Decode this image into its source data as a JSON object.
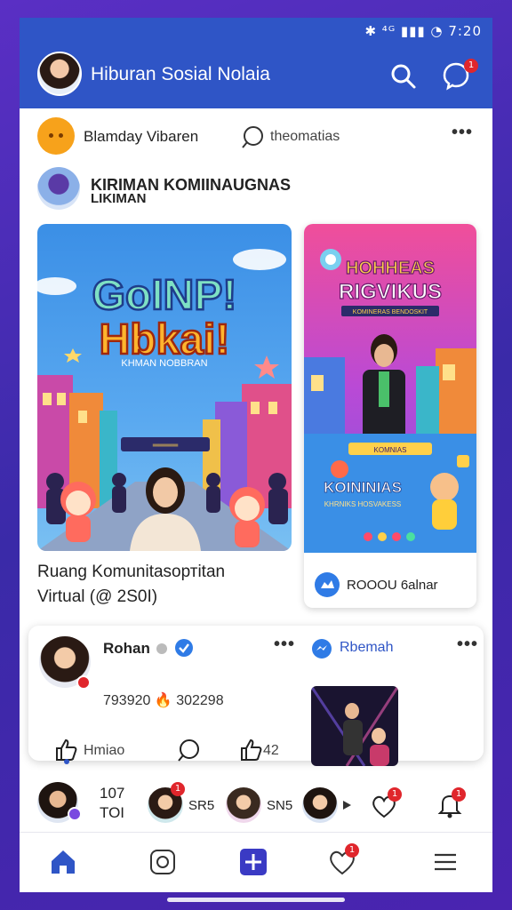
{
  "status": {
    "icons": "✱ ⁴ᴳ ▮▮▮ ◔",
    "time": "7:20"
  },
  "header": {
    "title": "Hiburan Sosial Nolaia",
    "notif_count": "1"
  },
  "post_row": {
    "name": "Blamday Vibaren",
    "action": "theomatias"
  },
  "section": {
    "title_line1": "KIRIMAN KOMIINAUGNAS",
    "title_line2": "LIKIMAN"
  },
  "main_card": {
    "headline1": "GoINP!",
    "headline2": "Hbkai!",
    "subtitle": "KHMAN NOBBRAN",
    "sign": "════",
    "caption_line1": "Ruang Komunitasортitan",
    "caption_line2": "Virtual (@ 2S0I)"
  },
  "side_card": {
    "top1": "HOHHEAS",
    "top2": "RIGVIKUS",
    "top3": "KOMINERAS BENDOSKIT",
    "panel_sign": "KOMNIAS",
    "panel_title": "KOININIAS",
    "panel_sub": "KHRNIKS HOSVAKESS",
    "footer": "ROOOU 6alnar"
  },
  "feed": {
    "name": "Rohan",
    "stats": "793920 🔥 302298",
    "like_label": "Hmiao",
    "share_count": "42",
    "side_name": "Rbemah"
  },
  "stories": {
    "count1": "107",
    "count1b": "TOI",
    "count2": "SR5",
    "count3": "SN5",
    "badge": "1"
  },
  "colors": {
    "accent": "#2f55c6",
    "badge": "#e0262c",
    "brand_bg": "#4a28b4"
  }
}
